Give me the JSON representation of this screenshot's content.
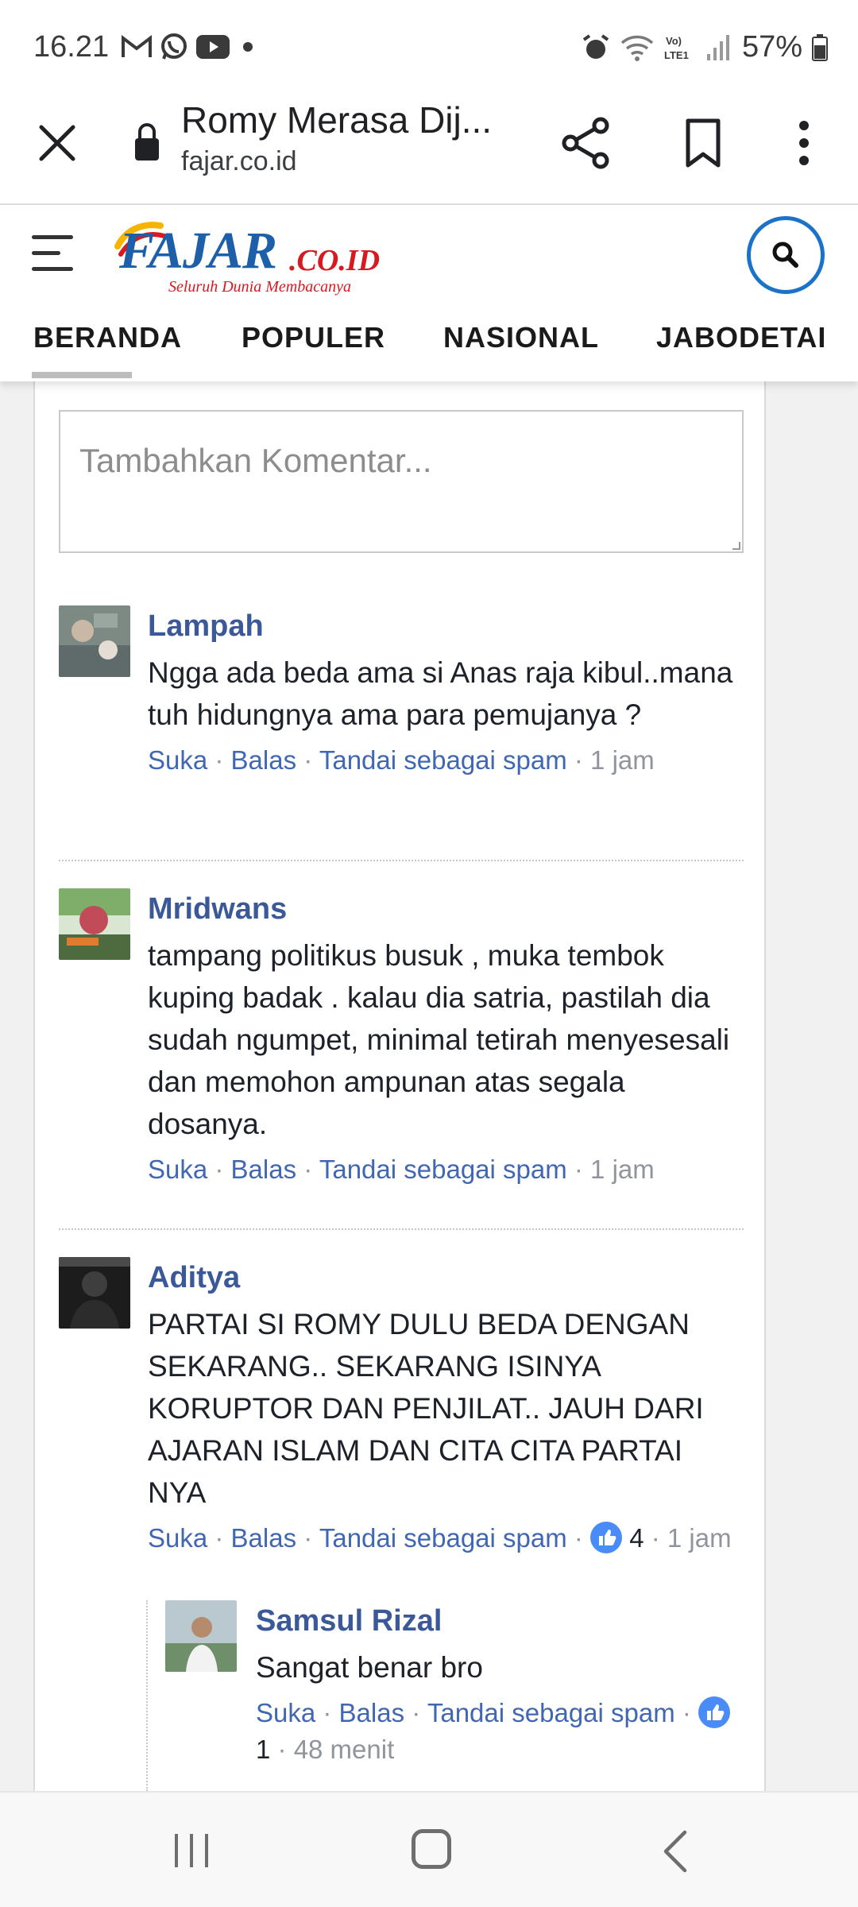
{
  "status_bar": {
    "time": "16.21",
    "battery": "57%",
    "network_label": "Vo) LTE1"
  },
  "browser": {
    "title": "Romy Merasa Dij...",
    "domain": "fajar.co.id"
  },
  "site": {
    "logo_text": "FAJAR",
    "logo_tld": ".CO.ID",
    "logo_tagline": "Seluruh Dunia Membacanya",
    "nav_tabs": [
      "BERANDA",
      "POPULER",
      "NASIONAL",
      "JABODETAI"
    ],
    "brand_color": "#1d5fa8"
  },
  "comment_input": {
    "placeholder": "Tambahkan Komentar..."
  },
  "comments": [
    {
      "author": "Lampah",
      "text": "Ngga ada beda ama si Anas raja kibul..mana tuh hidungnya ama para pemujanya ?",
      "like": "Suka",
      "reply": "Balas",
      "spam": "Tandai sebagai spam",
      "time": "1 jam"
    },
    {
      "author": "Mridwans",
      "text": "tampang politikus busuk , muka tembok kuping badak . kalau dia satria, pastilah dia sudah ngumpet, minimal tetirah menyesesali dan memohon ampunan atas segala dosanya.",
      "like": "Suka",
      "reply": "Balas",
      "spam": "Tandai sebagai spam",
      "time": "1 jam"
    },
    {
      "author": "Aditya",
      "text": "PARTAI SI ROMY DULU BEDA DENGAN SEKARANG.. SEKARANG ISINYA KORUPTOR DAN PENJILAT.. JAUH DARI AJARAN ISLAM DAN CITA CITA PARTAI NYA",
      "like": "Suka",
      "reply": "Balas",
      "spam": "Tandai sebagai spam",
      "likes_count": "4",
      "time": "1 jam"
    }
  ],
  "reply": {
    "author": "Samsul Rizal",
    "text": "Sangat benar bro",
    "like": "Suka",
    "reply": "Balas",
    "spam": "Tandai sebagai spam",
    "likes_count": "1",
    "time": "48 menit"
  }
}
